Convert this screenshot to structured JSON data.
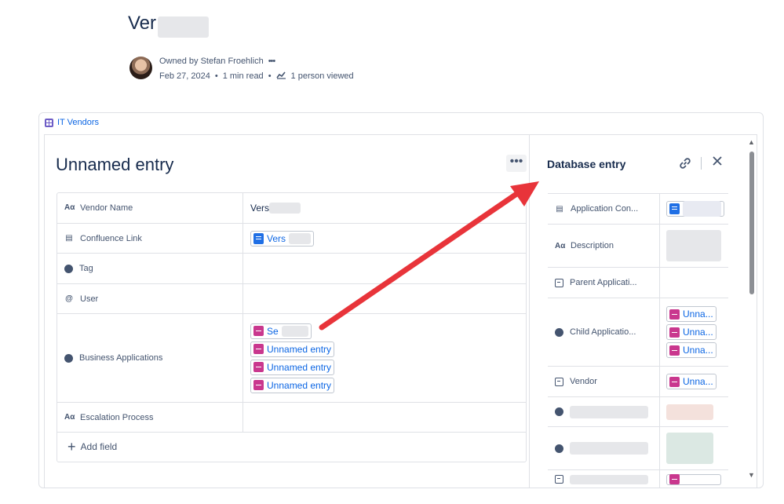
{
  "page": {
    "title": "Ver"
  },
  "byline": {
    "owner": "Owned by Stefan Froehlich",
    "more": "•••",
    "date": "Feb 27, 2024",
    "read_time": "1 min read",
    "views": "1 person viewed"
  },
  "database_link": "IT Vendors",
  "entry": {
    "title": "Unnamed entry",
    "more": "•••",
    "fields": [
      {
        "icon": "Aα",
        "label": "Vendor Name",
        "value": "Vers"
      },
      {
        "icon": "▤",
        "label": "Confluence Link",
        "value": "Vers"
      },
      {
        "icon": "●",
        "label": "Tag"
      },
      {
        "icon": "@",
        "label": "User"
      },
      {
        "icon": "◐",
        "label": "Business Applications",
        "chips": [
          "Se",
          "Unnamed entry",
          "Unnamed entry",
          "Unnamed entry"
        ]
      },
      {
        "icon": "Aα",
        "label": "Escalation Process"
      }
    ],
    "add_field": "Add field"
  },
  "panel": {
    "title": "Database entry",
    "fields": [
      {
        "label": "Application Con..."
      },
      {
        "label": "Description"
      },
      {
        "label": "Parent Applicati..."
      },
      {
        "label": "Child Applicatio...",
        "chips": [
          "Unna...",
          "Unna...",
          "Unna..."
        ]
      },
      {
        "label": "Vendor",
        "chips": [
          "Unna..."
        ]
      }
    ]
  }
}
